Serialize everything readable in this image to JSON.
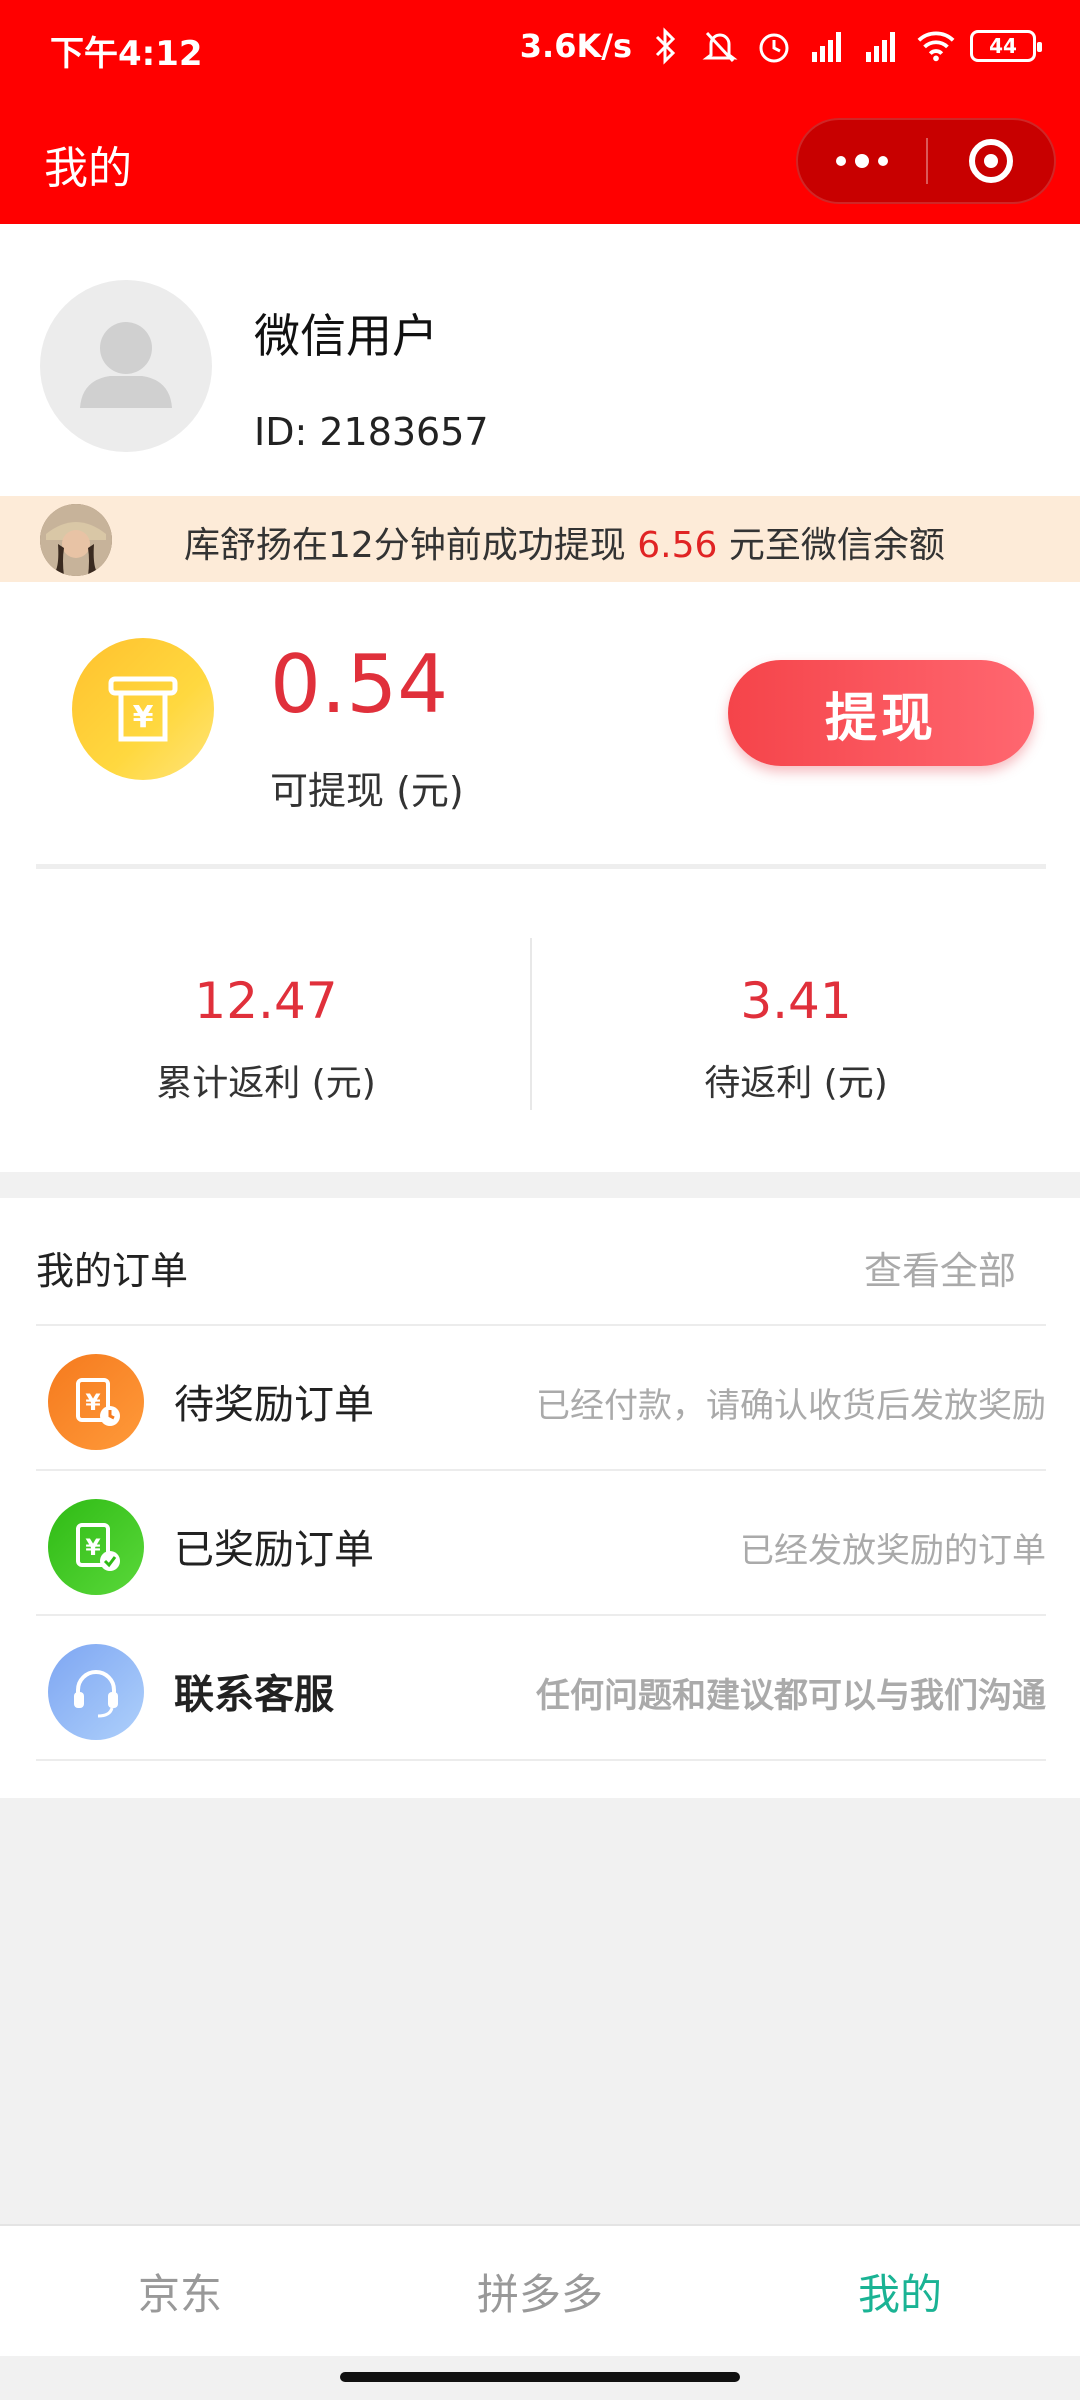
{
  "status_bar": {
    "time": "下午4:12",
    "network_speed": "3.6K/s",
    "battery": "44"
  },
  "nav": {
    "title": "我的"
  },
  "profile": {
    "nickname": "微信用户",
    "id_text": "ID: 2183657"
  },
  "notice": {
    "prefix": "库舒扬在12分钟前成功提现 ",
    "amount": "6.56",
    "suffix": " 元至微信余额"
  },
  "balance": {
    "value": "0.54",
    "label": "可提现 (元)",
    "withdraw_label": "提现",
    "cumulative_value": "12.47",
    "cumulative_label": "累计返利 (元)",
    "pending_value": "3.41",
    "pending_label": "待返利 (元)"
  },
  "orders": {
    "title": "我的订单",
    "view_all": "查看全部",
    "rows": [
      {
        "title": "待奖励订单",
        "desc": "已经付款，请确认收货后发放奖励",
        "icon": "pending-reward-icon",
        "color": "#ff7a1f"
      },
      {
        "title": "已奖励订单",
        "desc": "已经发放奖励的订单",
        "icon": "rewarded-icon",
        "color": "#3cc21b"
      },
      {
        "title": "联系客服",
        "desc": "任何问题和建议都可以与我们沟通",
        "icon": "headset-icon",
        "color": "#8fb0f5"
      }
    ]
  },
  "tabs": [
    "京东",
    "拼多多",
    "我的"
  ],
  "colors": {
    "header": "#ff0000",
    "accent_red": "#e0303b",
    "tab_active": "#1ab394"
  }
}
